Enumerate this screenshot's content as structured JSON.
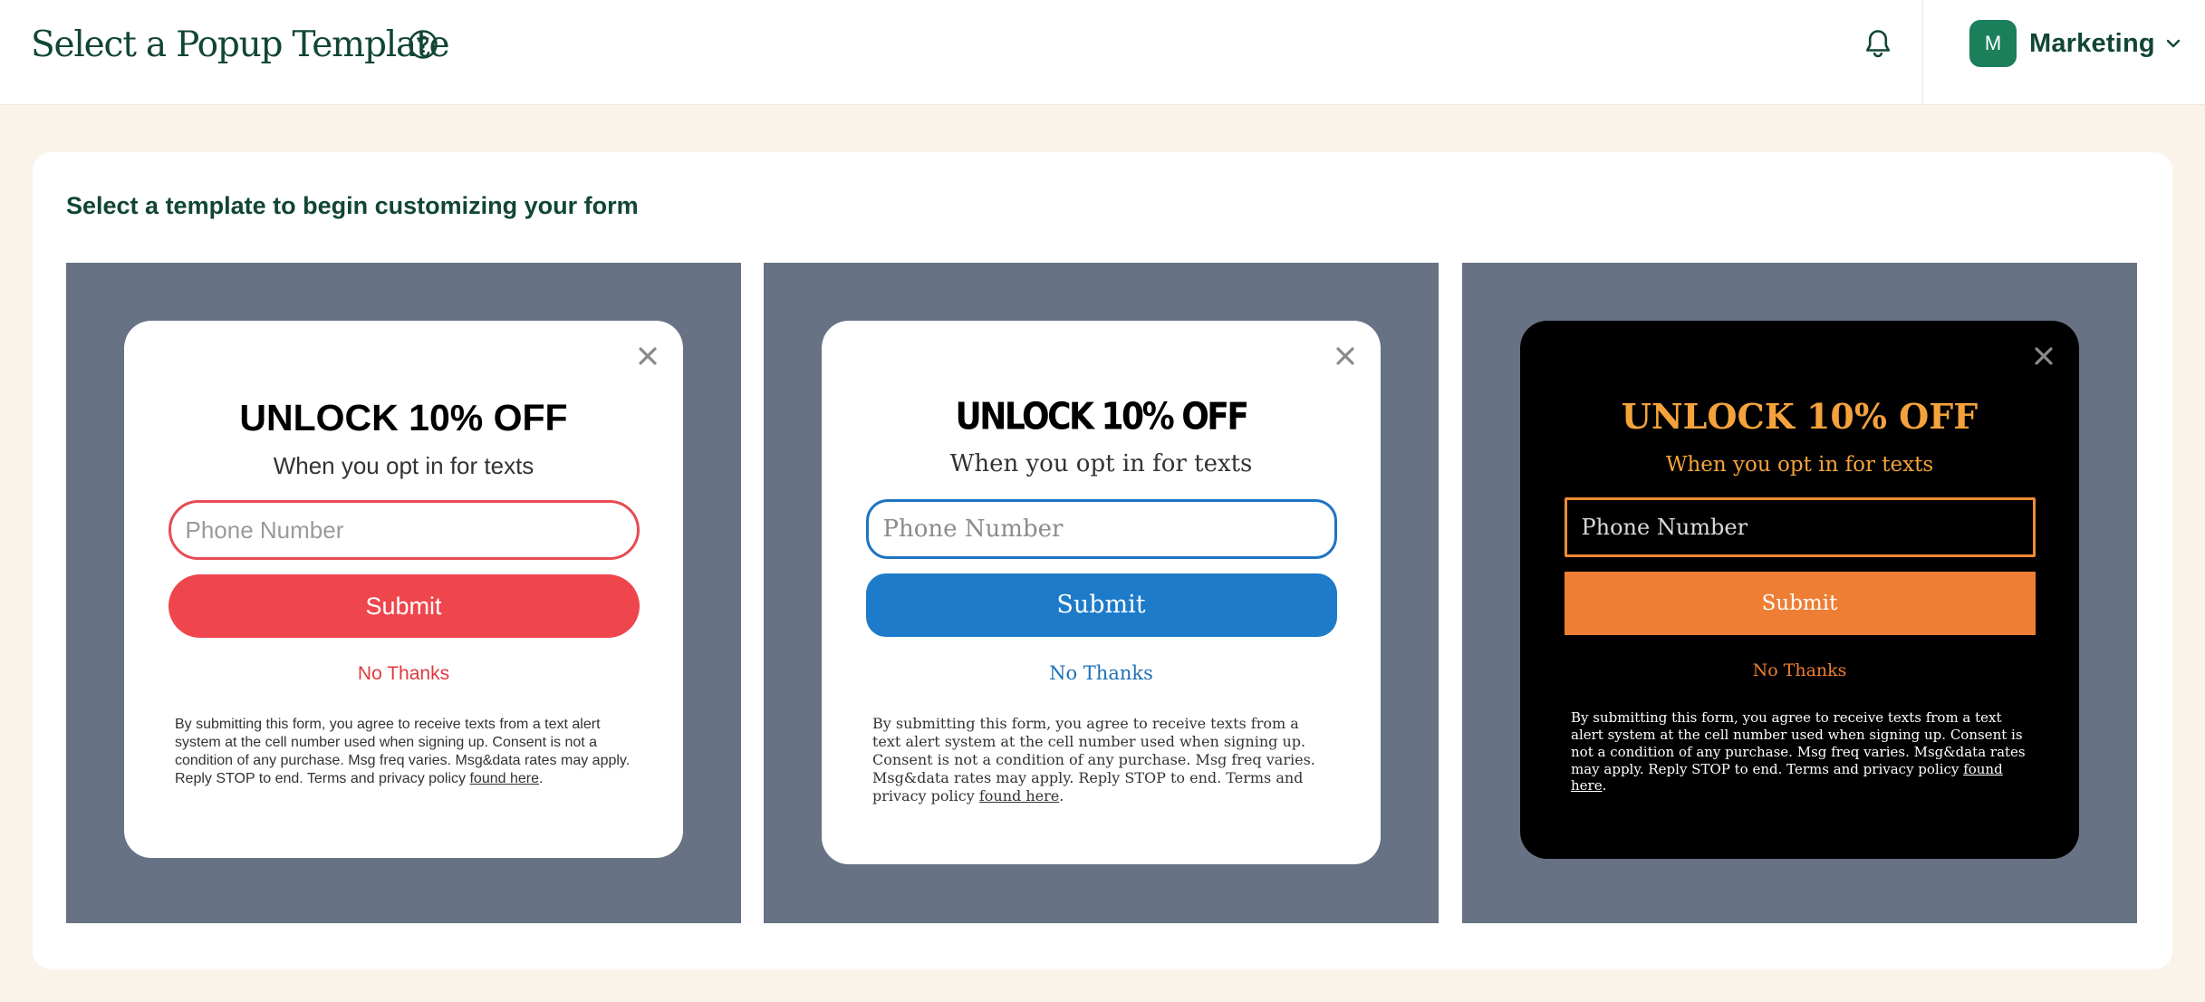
{
  "header": {
    "title": "Select a Popup Template",
    "help_icon": "help-circle-icon",
    "notifications_icon": "bell-icon",
    "account": {
      "initial": "M",
      "name": "Marketing",
      "avatar_color": "#1a7f5a"
    }
  },
  "main": {
    "subtitle": "Select a template to begin customizing your form",
    "templates": [
      {
        "headline": "UNLOCK 10% OFF",
        "tagline": "When you opt in for texts",
        "phone_placeholder": "Phone Number",
        "submit_label": "Submit",
        "decline_label": "No Thanks",
        "legal_text": "By submitting this form, you agree to receive texts from a text alert system at the cell number used when signing up. Consent is not a condition of any purchase. Msg freq varies. Msg&data rates may apply. Reply STOP to end. Terms and privacy policy ",
        "legal_link": "found here",
        "legal_end": ".",
        "accent_color": "#ef464d",
        "background_color": "#ffffff"
      },
      {
        "headline": "UNLOCK 10% OFF",
        "tagline": "When you opt in for texts",
        "phone_placeholder": "Phone Number",
        "submit_label": "Submit",
        "decline_label": "No Thanks",
        "legal_text": "By submitting this form, you agree to receive texts from a text alert system at the cell number used when signing up. Consent is not a condition of any purchase. Msg freq varies. Msg&data rates may apply. Reply STOP to end. Terms and privacy policy ",
        "legal_link": "found here",
        "legal_end": ".",
        "accent_color": "#1e7bc9",
        "background_color": "#ffffff"
      },
      {
        "headline": "UNLOCK 10% OFF",
        "tagline": "When you opt in for texts",
        "phone_placeholder": "Phone Number",
        "submit_label": "Submit",
        "decline_label": "No Thanks",
        "legal_text": "By submitting this form, you agree to receive texts from a text alert system at the cell number used when signing up. Consent is not a condition of any purchase. Msg freq varies. Msg&data rates may apply. Reply STOP to end. Terms and privacy policy ",
        "legal_link": "found here",
        "legal_end": ".",
        "accent_color": "#ee7e33",
        "background_color": "#000000"
      }
    ],
    "tile_background": "#677284",
    "close_icon": "close-icon"
  }
}
